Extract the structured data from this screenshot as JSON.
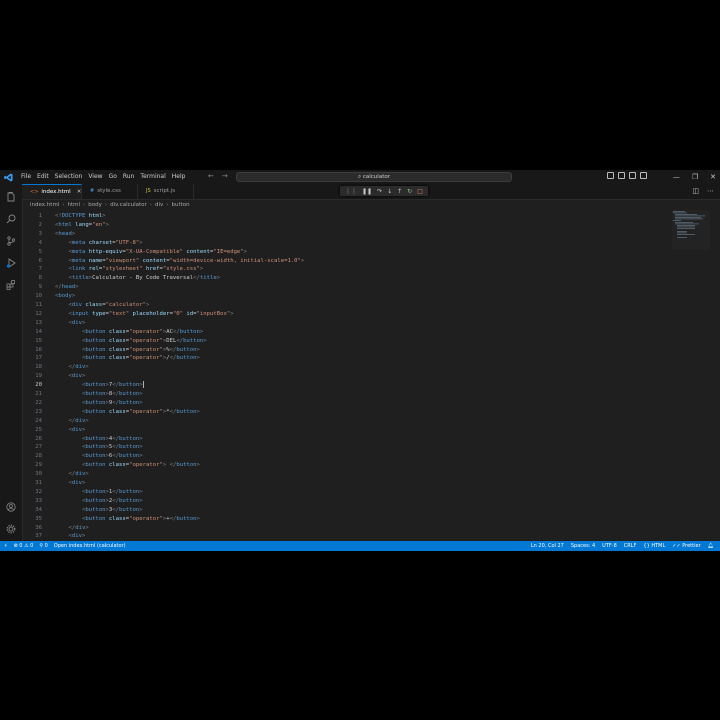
{
  "menu": [
    "File",
    "Edit",
    "Selection",
    "View",
    "Go",
    "Run",
    "Terminal",
    "Help"
  ],
  "command_center": "calculator",
  "tabs": [
    {
      "label": "index.html",
      "icon": "html-file-icon",
      "active": true
    },
    {
      "label": "style.css",
      "icon": "css-file-icon",
      "active": false
    },
    {
      "label": "script.js",
      "icon": "js-file-icon",
      "active": false
    }
  ],
  "breadcrumb": [
    "index.html",
    "html",
    "body",
    "div.calculator",
    "div",
    "button"
  ],
  "current_line": 20,
  "code_lines": [
    [
      [
        "t",
        "<!"
      ],
      [
        "tag",
        "DOCTYPE"
      ],
      [
        "attr",
        " html"
      ],
      [
        "t",
        ">"
      ]
    ],
    [
      [
        "t",
        "<"
      ],
      [
        "tag",
        "html"
      ],
      [
        "attr",
        " lang"
      ],
      [
        "txt",
        "="
      ],
      [
        "str",
        "\"en\""
      ],
      [
        "t",
        ">"
      ]
    ],
    [
      [
        "t",
        "<"
      ],
      [
        "tag",
        "head"
      ],
      [
        "t",
        ">"
      ]
    ],
    [
      [
        "txt",
        "    "
      ],
      [
        "t",
        "<"
      ],
      [
        "tag",
        "meta"
      ],
      [
        "attr",
        " charset"
      ],
      [
        "txt",
        "="
      ],
      [
        "str",
        "\"UTF-8\""
      ],
      [
        "t",
        ">"
      ]
    ],
    [
      [
        "txt",
        "    "
      ],
      [
        "t",
        "<"
      ],
      [
        "tag",
        "meta"
      ],
      [
        "attr",
        " http-equiv"
      ],
      [
        "txt",
        "="
      ],
      [
        "str",
        "\"X-UA-Compatible\""
      ],
      [
        "attr",
        " content"
      ],
      [
        "txt",
        "="
      ],
      [
        "str",
        "\"IE=edge\""
      ],
      [
        "t",
        ">"
      ]
    ],
    [
      [
        "txt",
        "    "
      ],
      [
        "t",
        "<"
      ],
      [
        "tag",
        "meta"
      ],
      [
        "attr",
        " name"
      ],
      [
        "txt",
        "="
      ],
      [
        "str",
        "\"viewport\""
      ],
      [
        "attr",
        " content"
      ],
      [
        "txt",
        "="
      ],
      [
        "str",
        "\"width=device-width, initial-scale=1.0\""
      ],
      [
        "t",
        ">"
      ]
    ],
    [
      [
        "txt",
        "    "
      ],
      [
        "t",
        "<"
      ],
      [
        "tag",
        "link"
      ],
      [
        "attr",
        " rel"
      ],
      [
        "txt",
        "="
      ],
      [
        "str",
        "\"stylesheet\""
      ],
      [
        "attr",
        " href"
      ],
      [
        "txt",
        "="
      ],
      [
        "str",
        "\"style.css\""
      ],
      [
        "t",
        ">"
      ]
    ],
    [
      [
        "txt",
        "    "
      ],
      [
        "t",
        "<"
      ],
      [
        "tag",
        "title"
      ],
      [
        "t",
        ">"
      ],
      [
        "txt",
        "Calculator - By Code Traversal"
      ],
      [
        "t",
        "</"
      ],
      [
        "tag",
        "title"
      ],
      [
        "t",
        ">"
      ]
    ],
    [
      [
        "t",
        "</"
      ],
      [
        "tag",
        "head"
      ],
      [
        "t",
        ">"
      ]
    ],
    [
      [
        "t",
        "<"
      ],
      [
        "tag",
        "body"
      ],
      [
        "t",
        ">"
      ]
    ],
    [
      [
        "txt",
        "    "
      ],
      [
        "t",
        "<"
      ],
      [
        "tag",
        "div"
      ],
      [
        "attr",
        " class"
      ],
      [
        "txt",
        "="
      ],
      [
        "str",
        "\"calculator\""
      ],
      [
        "t",
        ">"
      ]
    ],
    [
      [
        "txt",
        "    "
      ],
      [
        "t",
        "<"
      ],
      [
        "tag",
        "input"
      ],
      [
        "attr",
        " type"
      ],
      [
        "txt",
        "="
      ],
      [
        "str",
        "\"text\""
      ],
      [
        "attr",
        " placeholder"
      ],
      [
        "txt",
        "="
      ],
      [
        "str",
        "\"0\""
      ],
      [
        "attr",
        " id"
      ],
      [
        "txt",
        "="
      ],
      [
        "str",
        "\"inputBox\""
      ],
      [
        "t",
        ">"
      ]
    ],
    [
      [
        "txt",
        "    "
      ],
      [
        "t",
        "<"
      ],
      [
        "tag",
        "div"
      ],
      [
        "t",
        ">"
      ]
    ],
    [
      [
        "txt",
        "        "
      ],
      [
        "t",
        "<"
      ],
      [
        "tag",
        "button"
      ],
      [
        "attr",
        " class"
      ],
      [
        "txt",
        "="
      ],
      [
        "str",
        "\"operator\""
      ],
      [
        "t",
        ">"
      ],
      [
        "txt",
        "AC"
      ],
      [
        "t",
        "</"
      ],
      [
        "tag",
        "button"
      ],
      [
        "t",
        ">"
      ]
    ],
    [
      [
        "txt",
        "        "
      ],
      [
        "t",
        "<"
      ],
      [
        "tag",
        "button"
      ],
      [
        "attr",
        " class"
      ],
      [
        "txt",
        "="
      ],
      [
        "str",
        "\"operator\""
      ],
      [
        "t",
        ">"
      ],
      [
        "txt",
        "DEL"
      ],
      [
        "t",
        "</"
      ],
      [
        "tag",
        "button"
      ],
      [
        "t",
        ">"
      ]
    ],
    [
      [
        "txt",
        "        "
      ],
      [
        "t",
        "<"
      ],
      [
        "tag",
        "button"
      ],
      [
        "attr",
        " class"
      ],
      [
        "txt",
        "="
      ],
      [
        "str",
        "\"operator\""
      ],
      [
        "t",
        ">"
      ],
      [
        "txt",
        "%"
      ],
      [
        "t",
        "</"
      ],
      [
        "tag",
        "button"
      ],
      [
        "t",
        ">"
      ]
    ],
    [
      [
        "txt",
        "        "
      ],
      [
        "t",
        "<"
      ],
      [
        "tag",
        "button"
      ],
      [
        "attr",
        " class"
      ],
      [
        "txt",
        "="
      ],
      [
        "str",
        "\"operator\""
      ],
      [
        "t",
        ">"
      ],
      [
        "txt",
        "/"
      ],
      [
        "t",
        "</"
      ],
      [
        "tag",
        "button"
      ],
      [
        "t",
        ">"
      ]
    ],
    [
      [
        "txt",
        "    "
      ],
      [
        "t",
        "</"
      ],
      [
        "tag",
        "div"
      ],
      [
        "t",
        ">"
      ]
    ],
    [
      [
        "txt",
        "    "
      ],
      [
        "t",
        "<"
      ],
      [
        "tag",
        "div"
      ],
      [
        "t",
        ">"
      ]
    ],
    [
      [
        "txt",
        "        "
      ],
      [
        "t",
        "<"
      ],
      [
        "tag",
        "button"
      ],
      [
        "t",
        ">"
      ],
      [
        "txt",
        "7"
      ],
      [
        "t",
        "</"
      ],
      [
        "tag",
        "button"
      ],
      [
        "t",
        ">"
      ]
    ],
    [
      [
        "txt",
        "        "
      ],
      [
        "t",
        "<"
      ],
      [
        "tag",
        "button"
      ],
      [
        "t",
        ">"
      ],
      [
        "txt",
        "8"
      ],
      [
        "t",
        "</"
      ],
      [
        "tag",
        "button"
      ],
      [
        "t",
        ">"
      ]
    ],
    [
      [
        "txt",
        "        "
      ],
      [
        "t",
        "<"
      ],
      [
        "tag",
        "button"
      ],
      [
        "t",
        ">"
      ],
      [
        "txt",
        "9"
      ],
      [
        "t",
        "</"
      ],
      [
        "tag",
        "button"
      ],
      [
        "t",
        ">"
      ]
    ],
    [
      [
        "txt",
        "        "
      ],
      [
        "t",
        "<"
      ],
      [
        "tag",
        "button"
      ],
      [
        "attr",
        " class"
      ],
      [
        "txt",
        "="
      ],
      [
        "str",
        "\"operator\""
      ],
      [
        "t",
        ">"
      ],
      [
        "txt",
        "*"
      ],
      [
        "t",
        "</"
      ],
      [
        "tag",
        "button"
      ],
      [
        "t",
        ">"
      ]
    ],
    [
      [
        "txt",
        "    "
      ],
      [
        "t",
        "</"
      ],
      [
        "tag",
        "div"
      ],
      [
        "t",
        ">"
      ]
    ],
    [
      [
        "txt",
        "    "
      ],
      [
        "t",
        "<"
      ],
      [
        "tag",
        "div"
      ],
      [
        "t",
        ">"
      ]
    ],
    [
      [
        "txt",
        "        "
      ],
      [
        "t",
        "<"
      ],
      [
        "tag",
        "button"
      ],
      [
        "t",
        ">"
      ],
      [
        "txt",
        "4"
      ],
      [
        "t",
        "</"
      ],
      [
        "tag",
        "button"
      ],
      [
        "t",
        ">"
      ]
    ],
    [
      [
        "txt",
        "        "
      ],
      [
        "t",
        "<"
      ],
      [
        "tag",
        "button"
      ],
      [
        "t",
        ">"
      ],
      [
        "txt",
        "5"
      ],
      [
        "t",
        "</"
      ],
      [
        "tag",
        "button"
      ],
      [
        "t",
        ">"
      ]
    ],
    [
      [
        "txt",
        "        "
      ],
      [
        "t",
        "<"
      ],
      [
        "tag",
        "button"
      ],
      [
        "t",
        ">"
      ],
      [
        "txt",
        "6"
      ],
      [
        "t",
        "</"
      ],
      [
        "tag",
        "button"
      ],
      [
        "t",
        ">"
      ]
    ],
    [
      [
        "txt",
        "        "
      ],
      [
        "t",
        "<"
      ],
      [
        "tag",
        "button"
      ],
      [
        "attr",
        " class"
      ],
      [
        "txt",
        "="
      ],
      [
        "str",
        "\"operator\""
      ],
      [
        "t",
        ">"
      ],
      [
        "txt",
        " "
      ],
      [
        "t",
        "</"
      ],
      [
        "tag",
        "button"
      ],
      [
        "t",
        ">"
      ]
    ],
    [
      [
        "txt",
        "    "
      ],
      [
        "t",
        "</"
      ],
      [
        "tag",
        "div"
      ],
      [
        "t",
        ">"
      ]
    ],
    [
      [
        "txt",
        "    "
      ],
      [
        "t",
        "<"
      ],
      [
        "tag",
        "div"
      ],
      [
        "t",
        ">"
      ]
    ],
    [
      [
        "txt",
        "        "
      ],
      [
        "t",
        "<"
      ],
      [
        "tag",
        "button"
      ],
      [
        "t",
        ">"
      ],
      [
        "txt",
        "1"
      ],
      [
        "t",
        "</"
      ],
      [
        "tag",
        "button"
      ],
      [
        "t",
        ">"
      ]
    ],
    [
      [
        "txt",
        "        "
      ],
      [
        "t",
        "<"
      ],
      [
        "tag",
        "button"
      ],
      [
        "t",
        ">"
      ],
      [
        "txt",
        "2"
      ],
      [
        "t",
        "</"
      ],
      [
        "tag",
        "button"
      ],
      [
        "t",
        ">"
      ]
    ],
    [
      [
        "txt",
        "        "
      ],
      [
        "t",
        "<"
      ],
      [
        "tag",
        "button"
      ],
      [
        "t",
        ">"
      ],
      [
        "txt",
        "3"
      ],
      [
        "t",
        "</"
      ],
      [
        "tag",
        "button"
      ],
      [
        "t",
        ">"
      ]
    ],
    [
      [
        "txt",
        "        "
      ],
      [
        "t",
        "<"
      ],
      [
        "tag",
        "button"
      ],
      [
        "attr",
        " class"
      ],
      [
        "txt",
        "="
      ],
      [
        "str",
        "\"operator\""
      ],
      [
        "t",
        ">"
      ],
      [
        "txt",
        "+"
      ],
      [
        "t",
        "</"
      ],
      [
        "tag",
        "button"
      ],
      [
        "t",
        ">"
      ]
    ],
    [
      [
        "txt",
        "    "
      ],
      [
        "t",
        "</"
      ],
      [
        "tag",
        "div"
      ],
      [
        "t",
        ">"
      ]
    ],
    [
      [
        "txt",
        "    "
      ],
      [
        "t",
        "<"
      ],
      [
        "tag",
        "div"
      ],
      [
        "t",
        ">"
      ]
    ]
  ],
  "status": {
    "errors": "0",
    "warnings": "0",
    "ports": "0",
    "open_file": "Open index.html (calculator)",
    "position": "Ln 20, Col 27",
    "spaces": "Spaces: 4",
    "encoding": "UTF-8",
    "eol": "CRLF",
    "language": "HTML",
    "formatter": "Prettier"
  },
  "colors": {
    "accent": "#0078d4",
    "editor_bg": "#1f1f1f",
    "tag": "#569cd6",
    "attr": "#9cdcfe",
    "string": "#ce9178"
  }
}
